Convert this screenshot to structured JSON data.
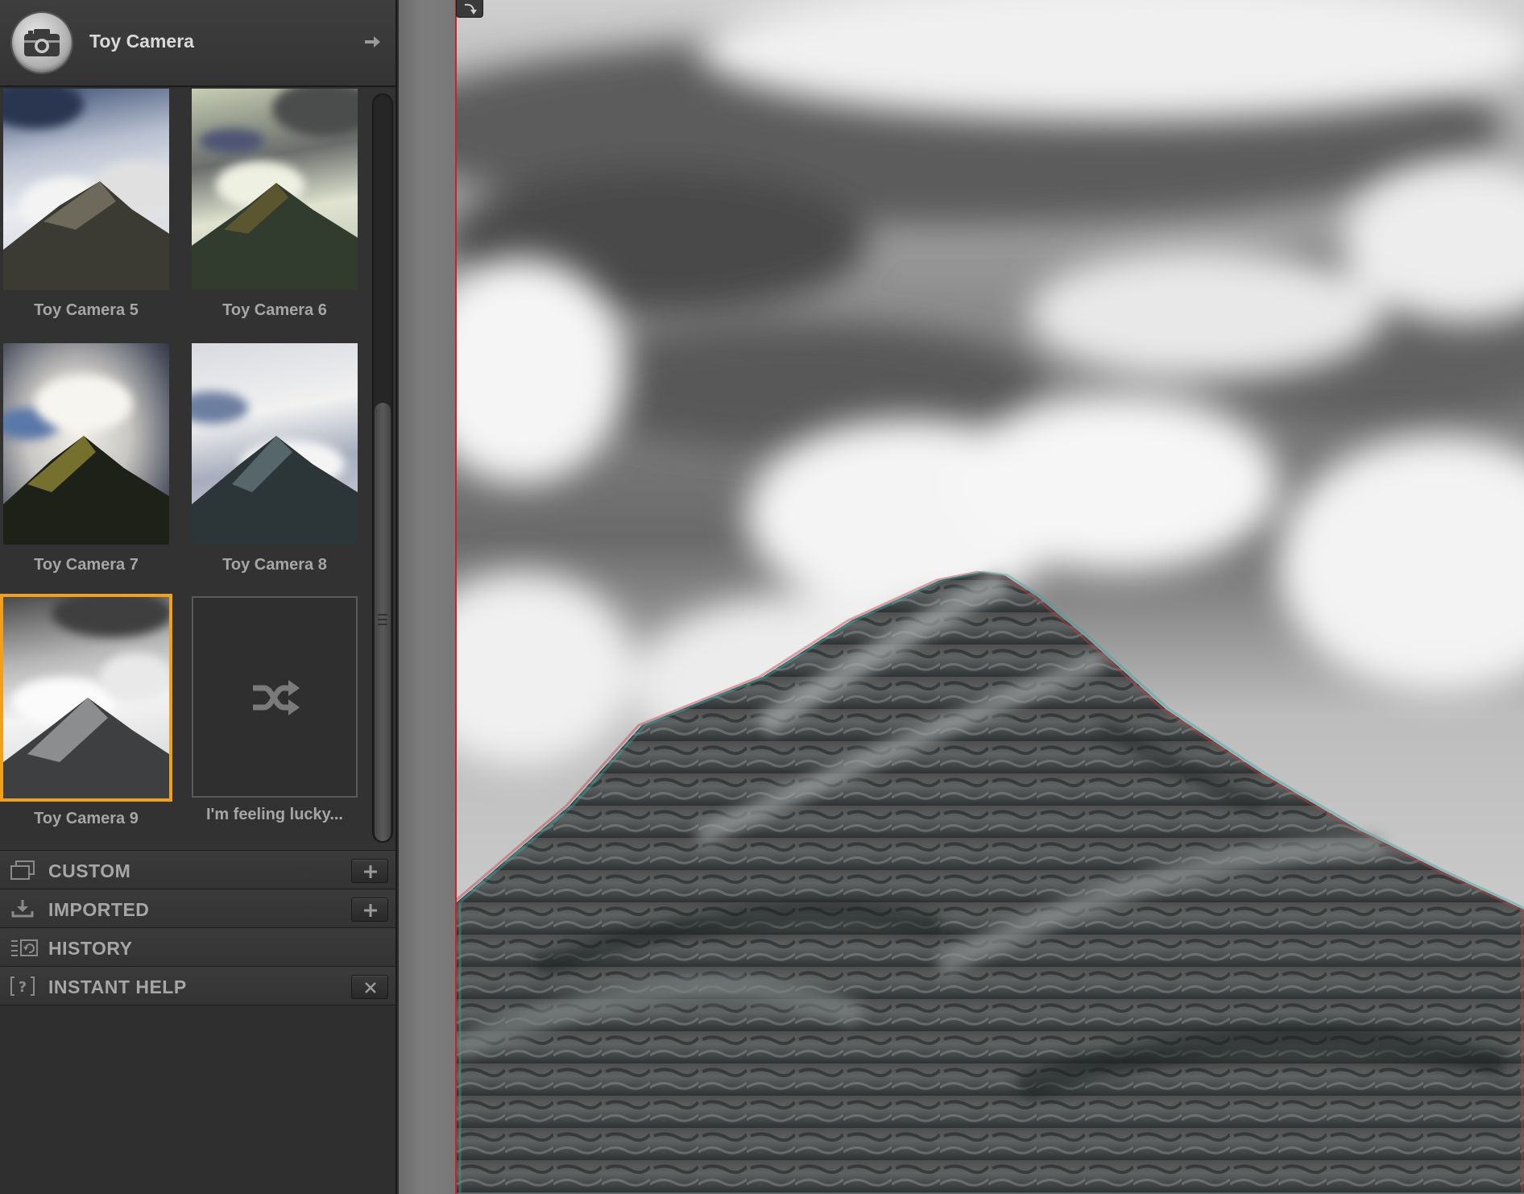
{
  "header": {
    "title": "Toy Camera",
    "icon": "camera-icon",
    "nav_icon": "arrow-right-icon"
  },
  "presets": [
    {
      "label": "Toy Camera 5",
      "selected": false
    },
    {
      "label": "Toy Camera 6",
      "selected": false
    },
    {
      "label": "Toy Camera 7",
      "selected": false
    },
    {
      "label": "Toy Camera 8",
      "selected": false
    },
    {
      "label": "Toy Camera 9",
      "selected": true
    },
    {
      "label": "I'm feeling lucky...",
      "icon": "shuffle-icon"
    }
  ],
  "sections": [
    {
      "label": "CUSTOM",
      "icon": "custom-presets-icon",
      "action_icon": "plus-icon"
    },
    {
      "label": "IMPORTED",
      "icon": "import-icon",
      "action_icon": "plus-icon"
    },
    {
      "label": "HISTORY",
      "icon": "history-icon"
    },
    {
      "label": "INSTANT HELP",
      "icon": "help-icon",
      "action_icon": "close-icon"
    }
  ],
  "colors": {
    "selection": "#f0a01c",
    "divider": "#c8222a",
    "panel": "#2e2e2e"
  }
}
